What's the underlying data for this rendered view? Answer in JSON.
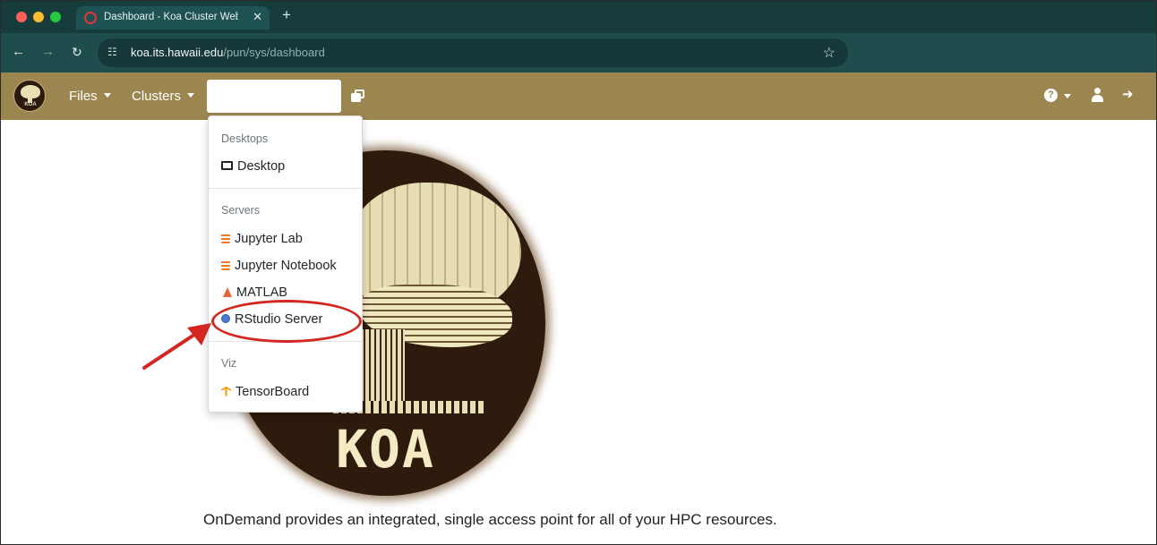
{
  "browser": {
    "tab": {
      "title": "Dashboard - Koa Cluster Web",
      "close_label": "✕"
    },
    "new_tab_label": "+",
    "address_bar": {
      "host": "koa.its.hawaii.edu",
      "path": "/pun/sys/dashboard"
    }
  },
  "navbar": {
    "brand": "KOA",
    "items": [
      {
        "label": "Files",
        "has_caret": true
      },
      {
        "label": "Clusters",
        "has_caret": true
      }
    ],
    "search": {
      "value": "",
      "placeholder": ""
    },
    "help_glyph": "?",
    "icons": [
      "apps-icon",
      "help-icon",
      "user-icon",
      "logout-icon"
    ]
  },
  "dropdown": {
    "sections": [
      {
        "header": "Desktops",
        "items": [
          {
            "label": "Desktop",
            "icon": "desktop-icon"
          }
        ]
      },
      {
        "header": "Servers",
        "items": [
          {
            "label": "Jupyter Lab",
            "icon": "jupyter-icon"
          },
          {
            "label": "Jupyter Notebook",
            "icon": "jupyter-icon"
          },
          {
            "label": "MATLAB",
            "icon": "matlab-icon"
          },
          {
            "label": "RStudio Server",
            "icon": "rstudio-icon",
            "highlighted": true
          }
        ]
      },
      {
        "header": "Viz",
        "items": [
          {
            "label": "TensorBoard",
            "icon": "tensorboard-icon"
          }
        ]
      }
    ]
  },
  "main": {
    "logo_text": "KOA",
    "tagline": "OnDemand provides an integrated, single access point for all of your HPC resources."
  },
  "colors": {
    "tabstrip": "#173c3c",
    "toolbar": "#1f4d4d",
    "navbar": "#9b8650",
    "annotation": "#d32620",
    "logo_bg": "#2e1b0d"
  }
}
